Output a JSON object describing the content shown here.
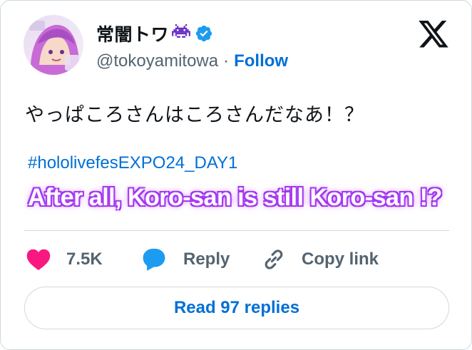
{
  "author": {
    "display_name": "常闇トワ",
    "handle": "@tokoyamitowa",
    "separator": "·",
    "follow_label": "Follow",
    "verified": true,
    "name_emoji": "alien-monster-icon"
  },
  "brand": {
    "logo": "x-logo-icon"
  },
  "tweet": {
    "text": "やっぱころさんはころさんだなあ！？",
    "hashtag": "#hololivefesEXPO24_DAY1",
    "caption": "After all, Koro-san is still Koro-san !?"
  },
  "actions": {
    "like_count": "7.5K",
    "reply_label": "Reply",
    "copy_label": "Copy link"
  },
  "footer": {
    "read_replies_label": "Read 97 replies"
  },
  "colors": {
    "link": "#006fd6",
    "like": "#f91880",
    "reply": "#1d9bf0",
    "caption_glow": "#b44bff",
    "verified": "#1d9bf0",
    "muted": "#536471"
  }
}
